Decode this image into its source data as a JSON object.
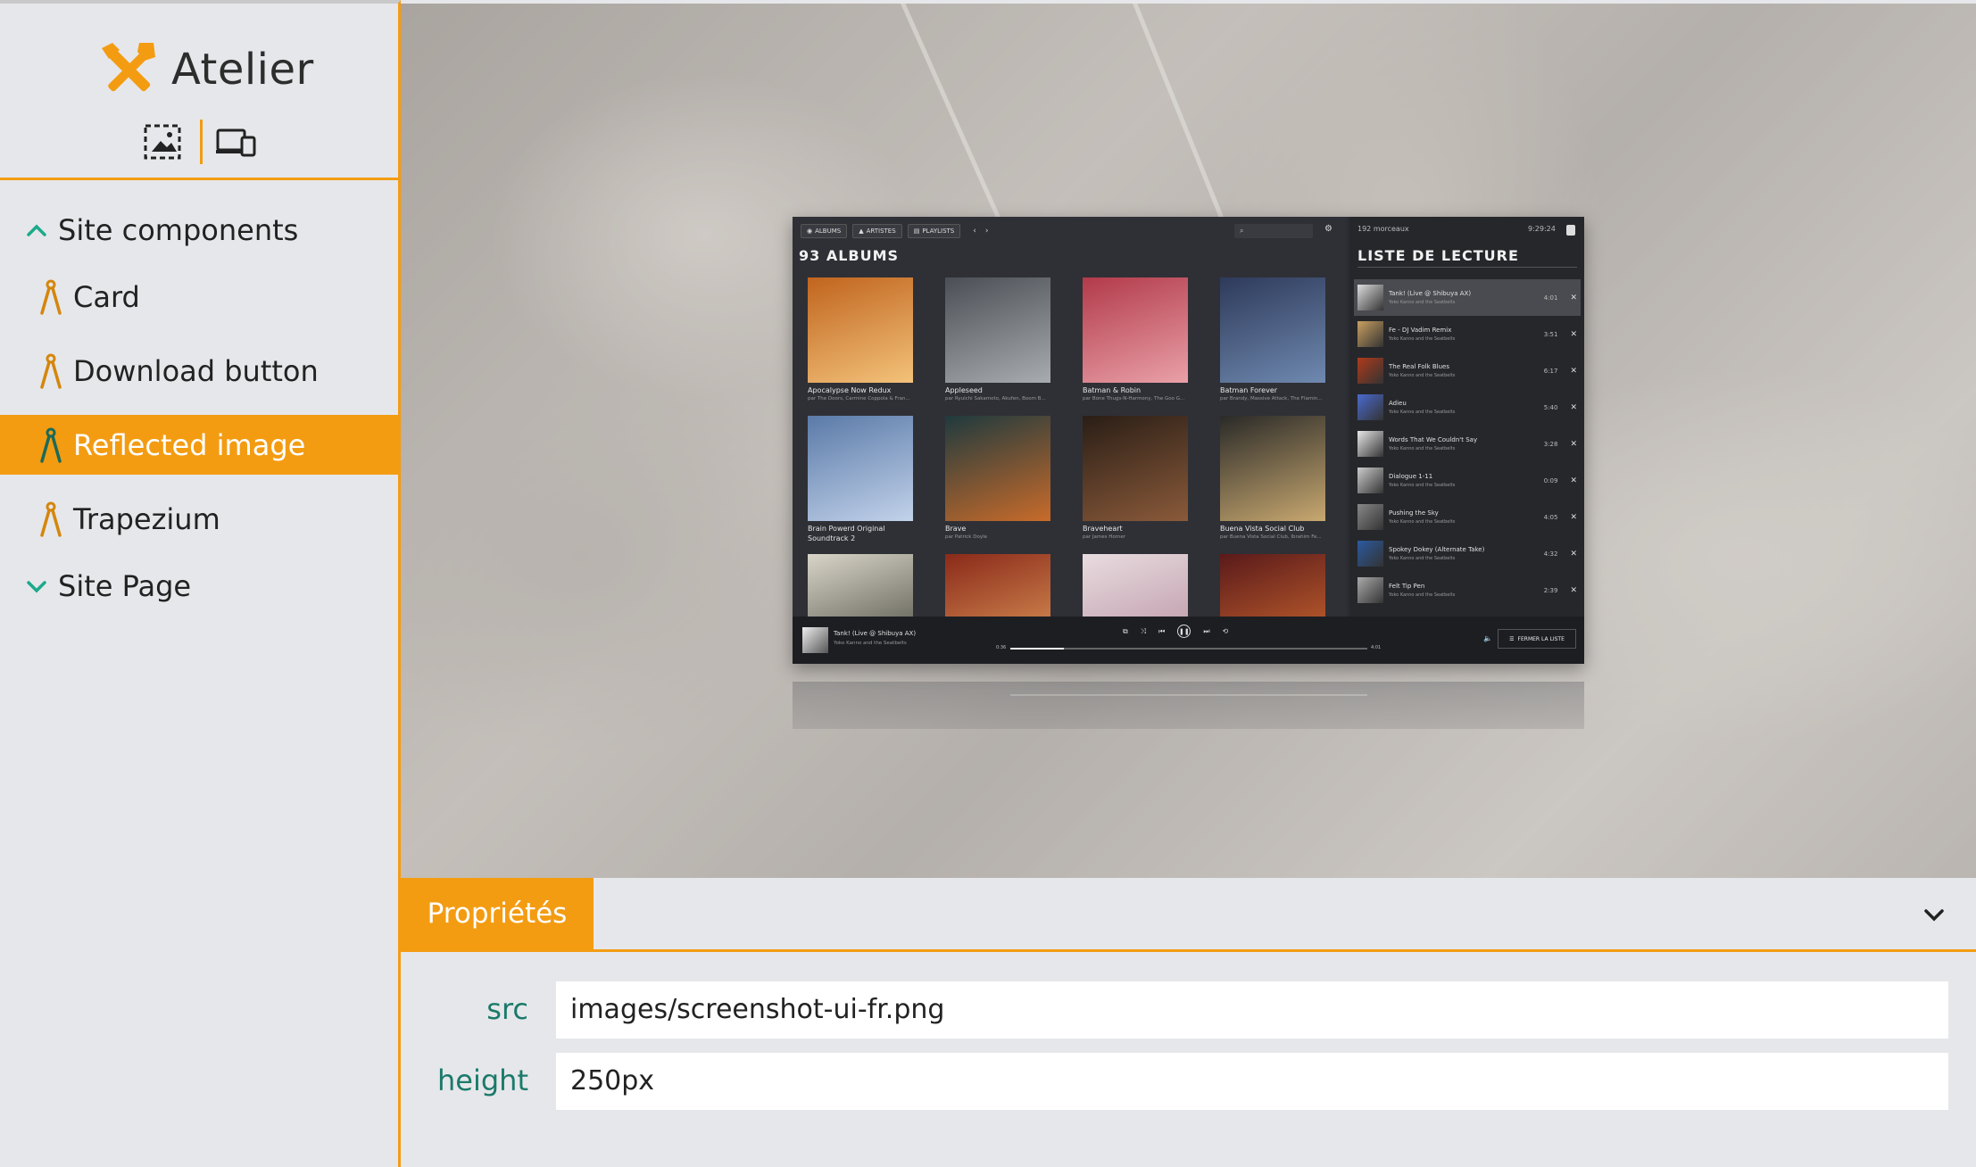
{
  "app": {
    "title": "Atelier"
  },
  "sidebar": {
    "groups": [
      {
        "label": "Site components",
        "expanded": true
      },
      {
        "label": "Site Page",
        "expanded": false
      }
    ],
    "items": [
      {
        "label": "Card",
        "active": false
      },
      {
        "label": "Download button",
        "active": false
      },
      {
        "label": "Reflected image",
        "active": true
      },
      {
        "label": "Trapezium",
        "active": false
      }
    ],
    "view_icons": [
      "image-frame-icon",
      "devices-icon"
    ]
  },
  "preview": {
    "app": {
      "tabs": [
        "ALBUMS",
        "ARTISTES",
        "PLAYLISTS"
      ],
      "albums_heading": "93 ALBUMS",
      "albums": [
        {
          "title": "Apocalypse Now Redux",
          "artist": "par The Doors, Carmine Coppola & Fran...",
          "color_a": "#c0641e",
          "color_b": "#f3c27a"
        },
        {
          "title": "Appleseed",
          "artist": "par Ryuichi Sakamoto, Akufen, Boom B...",
          "color_a": "#4b4f55",
          "color_b": "#a8acb0"
        },
        {
          "title": "Batman & Robin",
          "artist": "par Bone Thugs-N-Harmony, The Goo G...",
          "color_a": "#b23a4a",
          "color_b": "#e9a0a8"
        },
        {
          "title": "Batman Forever",
          "artist": "par Brandy, Massive Attack, The Flamin...",
          "color_a": "#2e3a5a",
          "color_b": "#6f89b0"
        },
        {
          "title": "Brain Powerd Original Soundtrack 2",
          "artist": "par Yoko Kanno",
          "color_a": "#5a7aa8",
          "color_b": "#c2d2ea"
        },
        {
          "title": "Brave",
          "artist": "par Patrick Doyle",
          "color_a": "#1f3a3e",
          "color_b": "#c86b2a"
        },
        {
          "title": "Braveheart",
          "artist": "par James Horner",
          "color_a": "#2a1e16",
          "color_b": "#8a5a3a"
        },
        {
          "title": "Buena Vista Social Club",
          "artist": "par Buena Vista Social Club, Ibrahim Fe...",
          "color_a": "#2a2a28",
          "color_b": "#c8a870"
        },
        {
          "title": "",
          "artist": "",
          "color_a": "#d8d4c8",
          "color_b": "#4a4a40"
        },
        {
          "title": "",
          "artist": "",
          "color_a": "#8a2a1a",
          "color_b": "#e09a5a"
        },
        {
          "title": "",
          "artist": "",
          "color_a": "#e8dce0",
          "color_b": "#b890a0"
        },
        {
          "title": "",
          "artist": "",
          "color_a": "#5a1a1a",
          "color_b": "#d06a30"
        }
      ],
      "playlist_count": "192 morceaux",
      "playlist_time": "9:29:24",
      "playlist_heading": "LISTE DE LECTURE",
      "tracks": [
        {
          "name": "Tank! (Live @ Shibuya AX)",
          "artist": "Yoko Kanno and the Seatbelts",
          "length": "4:01",
          "current": true
        },
        {
          "name": "Fe - DJ Vadim Remix",
          "artist": "Yoko Kanno and the Seatbelts",
          "length": "3:51",
          "current": false
        },
        {
          "name": "The Real Folk Blues",
          "artist": "Yoko Kanno and the Seatbelts",
          "length": "6:17",
          "current": false
        },
        {
          "name": "Adieu",
          "artist": "Yoko Kanno and the Seatbelts",
          "length": "5:40",
          "current": false
        },
        {
          "name": "Words That We Couldn't Say",
          "artist": "Yoko Kanno and the Seatbelts",
          "length": "3:28",
          "current": false
        },
        {
          "name": "Dialogue 1-11",
          "artist": "Yoko Kanno and the Seatbelts",
          "length": "0:09",
          "current": false
        },
        {
          "name": "Pushing the Sky",
          "artist": "Yoko Kanno and the Seatbelts",
          "length": "4:05",
          "current": false
        },
        {
          "name": "Spokey Dokey (Alternate Take)",
          "artist": "Yoko Kanno and the Seatbelts",
          "length": "4:32",
          "current": false
        },
        {
          "name": "Felt Tip Pen",
          "artist": "Yoko Kanno and the Seatbelts",
          "length": "2:39",
          "current": false
        }
      ],
      "now_playing": {
        "title": "Tank! (Live @ Shibuya AX)",
        "artist": "Yoko Kanno and the Seatbelts",
        "elapsed": "0:36",
        "duration": "4:01",
        "progress": 0.15
      },
      "close_list_label": "FERMER LA LISTE"
    }
  },
  "properties": {
    "tab_label": "Propriétés",
    "fields": [
      {
        "label": "src",
        "value": "images/screenshot-ui-fr.png"
      },
      {
        "label": "height",
        "value": "250px"
      }
    ]
  },
  "colors": {
    "accent": "#f39c12",
    "label": "#1a7a6a",
    "sidebar_bg": "#e6e7ea"
  }
}
